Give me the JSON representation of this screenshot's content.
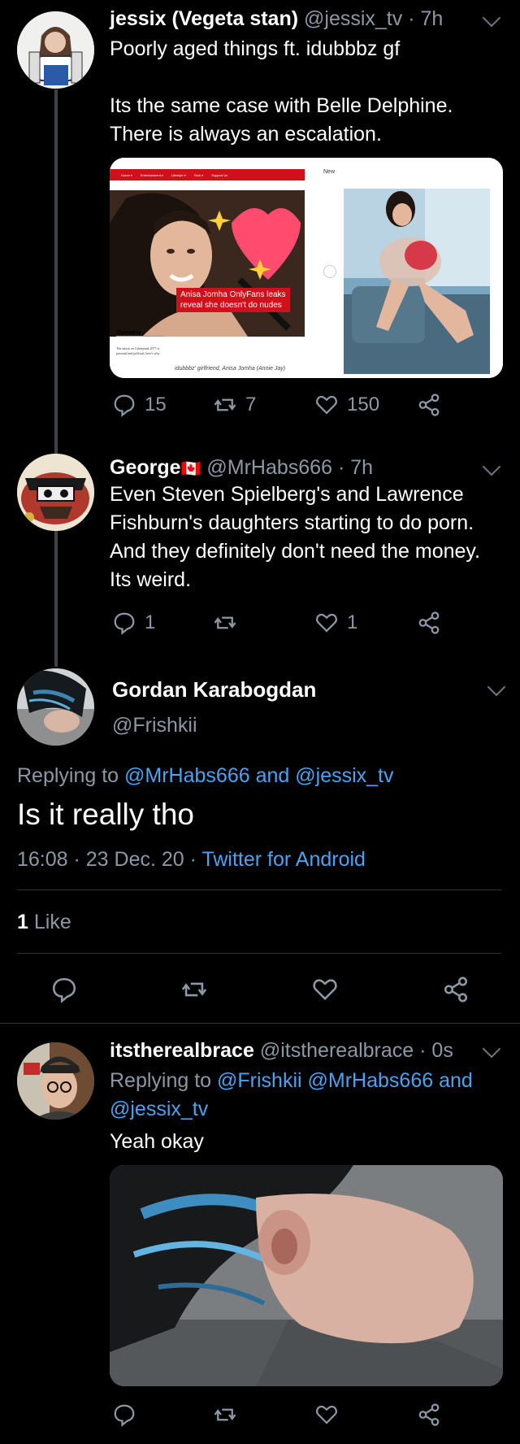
{
  "tweets": [
    {
      "name": "jessix (Vegeta stan)",
      "handle": "@jessix_tv",
      "time": "· 7h",
      "text_line1": "Poorly aged things ft. idubbbz gf",
      "text_line2": "Its the same case with Belle Delphine.",
      "text_line3": "There is always an escalation.",
      "replies": "15",
      "retweets": "7",
      "likes": "150",
      "media_left": {
        "nav": [
          "Home ▾",
          "Entertainment ▾",
          "Lifestyle ▾",
          "Tech ▾",
          "Support Us"
        ],
        "caption_line1": "Anisa Jomha OnlyFans leaks",
        "caption_line2": "reveal she doesn't do nudes",
        "opinions": "Opinions",
        "article": "The attack on Cyberpunk 2077 is personal and political, here's why",
        "credit": "idubbbz' girlfriend, Anisa Jomha (Annie Jay)"
      },
      "media_right": {
        "header": "New"
      }
    },
    {
      "name": "George",
      "flag": "🇨🇦",
      "handle": "@MrHabs666",
      "time": "· 7h",
      "text_line1": "Even Steven Spielberg's and Lawrence",
      "text_line2": "Fishburn's daughters starting to do porn.",
      "text_line3": "And they definitely don't need the money.",
      "text_line4": "Its weird.",
      "replies": "1",
      "retweets": "",
      "likes": "1"
    }
  ],
  "focused": {
    "name": "Gordan Karabogdan",
    "handle": "@Frishkii",
    "replying_prefix": "Replying to",
    "replying_to1": "@MrHabs666",
    "replying_and": "and",
    "replying_to2": "@jessix_tv",
    "text": "Is it really tho",
    "timestamp": "16:08 · 23 Dec. 20 ·",
    "source": "Twitter for Android",
    "like_count": "1",
    "like_label": "Like"
  },
  "reply": {
    "name": "itstherealbrace",
    "handle": "@itstherealbrace",
    "time": "· 0s",
    "replying_prefix": "Replying to",
    "replying_to1": "@Frishkii",
    "replying_to2": "@MrHabs666",
    "replying_and": "and",
    "replying_to3": "@jessix_tv",
    "text": "Yeah okay"
  },
  "colors": {
    "background": "#000000",
    "link": "#4aa3f0",
    "muted": "#8b98a5",
    "thread_line": "#3d4148"
  }
}
